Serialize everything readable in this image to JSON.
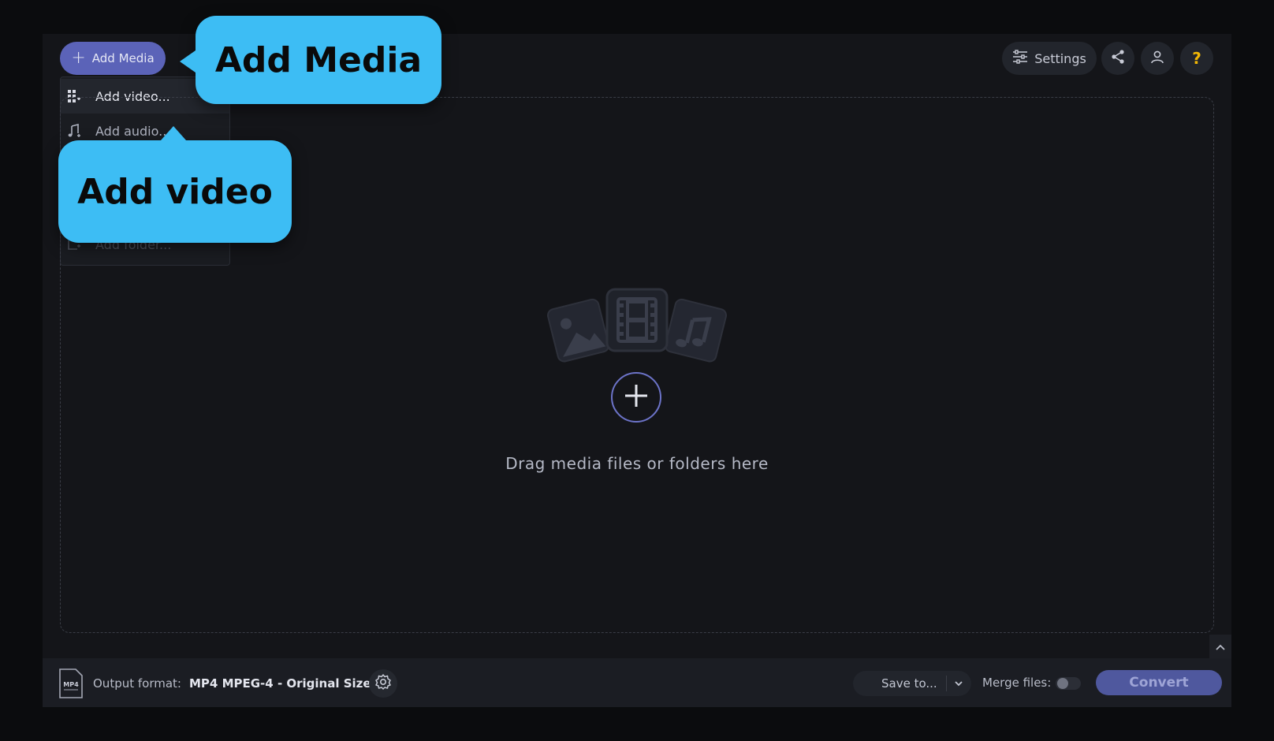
{
  "toolbar": {
    "add_media_label": "Add Media",
    "settings_label": "Settings",
    "help_label": "?"
  },
  "add_menu": {
    "items": [
      {
        "label": "Add video...",
        "icon": "video-grid-icon"
      },
      {
        "label": "Add audio...",
        "icon": "music-note-icon"
      },
      {
        "label": "Add folder...",
        "icon": "folder-add-icon"
      }
    ]
  },
  "dropzone": {
    "text": "Drag media files or folders here"
  },
  "bottom_bar": {
    "format_icon_text": "MP4",
    "output_format_label": "Output format:",
    "output_format_value": "MP4 MPEG-4 - Original Size",
    "save_label": "Save to...",
    "merge_label": "Merge files:",
    "merge_enabled": false,
    "convert_label": "Convert"
  },
  "callouts": {
    "media": "Add Media",
    "video": "Add video"
  },
  "colors": {
    "accent": "#5b63b8",
    "callout": "#3dbdf4",
    "help": "#f2b705",
    "background": "#141519"
  }
}
